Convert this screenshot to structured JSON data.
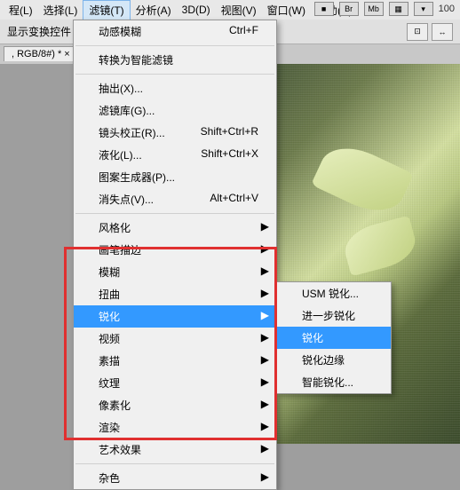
{
  "menubar": {
    "items": [
      "程(L)",
      "选择(L)",
      "滤镜(T)",
      "分析(A)",
      "3D(D)",
      "视图(V)",
      "窗口(W)",
      "帮助(H)"
    ],
    "activeIndex": 2
  },
  "top_icons": {
    "labels": [
      "■",
      "Br",
      "Mb",
      "▦",
      "▾"
    ],
    "zoom": "100"
  },
  "toolbar": {
    "label": "显示变换控件",
    "right": [
      "⊡",
      "↔"
    ]
  },
  "tab": {
    "label": ", RGB/8#) * ×"
  },
  "dropdown": {
    "groups": [
      [
        {
          "label": "动感模糊",
          "shortcut": "Ctrl+F"
        }
      ],
      [
        {
          "label": "转换为智能滤镜"
        }
      ],
      [
        {
          "label": "抽出(X)..."
        },
        {
          "label": "滤镜库(G)..."
        },
        {
          "label": "镜头校正(R)...",
          "shortcut": "Shift+Ctrl+R"
        },
        {
          "label": "液化(L)...",
          "shortcut": "Shift+Ctrl+X"
        },
        {
          "label": "图案生成器(P)..."
        },
        {
          "label": "消失点(V)...",
          "shortcut": "Alt+Ctrl+V"
        }
      ],
      [
        {
          "label": "风格化",
          "sub": true
        },
        {
          "label": "画笔描边",
          "sub": true
        },
        {
          "label": "模糊",
          "sub": true
        },
        {
          "label": "扭曲",
          "sub": true
        },
        {
          "label": "锐化",
          "sub": true,
          "hl": true
        },
        {
          "label": "视频",
          "sub": true
        },
        {
          "label": "素描",
          "sub": true
        },
        {
          "label": "纹理",
          "sub": true
        },
        {
          "label": "像素化",
          "sub": true
        },
        {
          "label": "渲染",
          "sub": true
        },
        {
          "label": "艺术效果",
          "sub": true
        }
      ],
      [
        {
          "label": "杂色",
          "sub": true
        }
      ]
    ]
  },
  "submenu": {
    "items": [
      {
        "label": "USM 锐化..."
      },
      {
        "label": "进一步锐化"
      },
      {
        "label": "锐化",
        "hl": true
      },
      {
        "label": "锐化边缘"
      },
      {
        "label": "智能锐化..."
      }
    ]
  }
}
